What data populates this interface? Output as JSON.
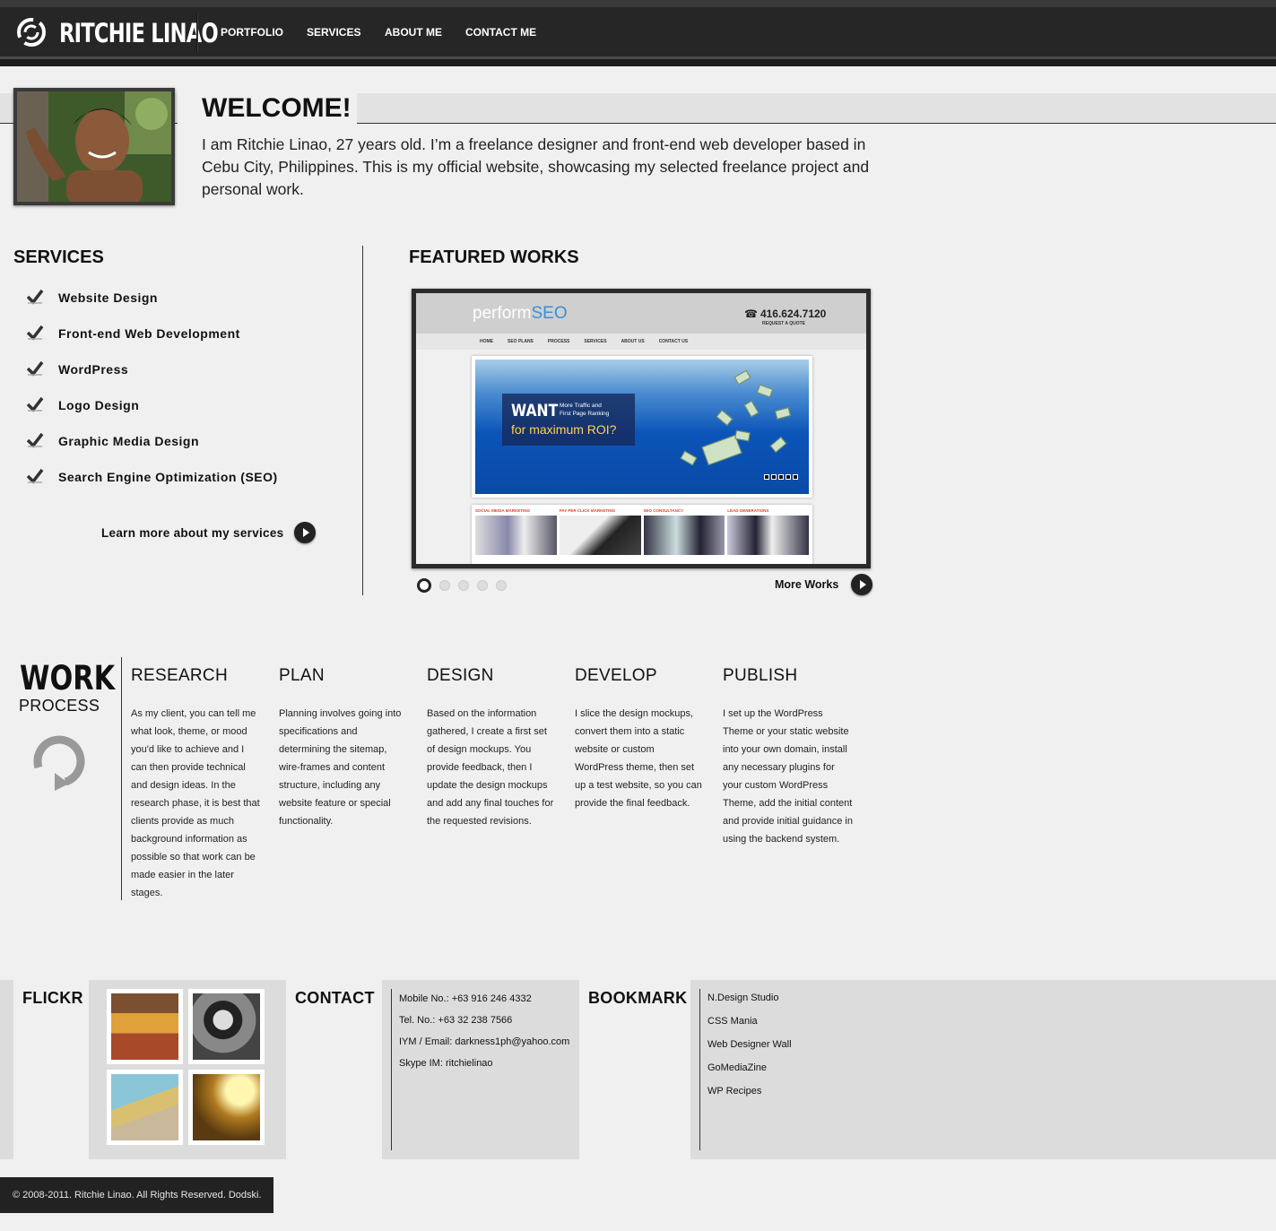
{
  "header": {
    "logo_text": "RITCHIE LINAO",
    "nav": [
      "PORTFOLIO",
      "SERVICES",
      "ABOUT ME",
      "CONTACT ME"
    ]
  },
  "welcome": {
    "title": "WELCOME!",
    "text": "I am Ritchie Linao, 27 years old. I’m a freelance designer and front-end web developer based in Cebu City, Philippines. This is my official website, showcasing my selected freelance project and personal work."
  },
  "services": {
    "title": "SERVICES",
    "items": [
      "Website Design",
      "Front-end Web Development",
      "WordPress",
      "Logo Design",
      "Graphic Media Design",
      "Search Engine Optimization (SEO)"
    ],
    "learn_more": "Learn more about my services"
  },
  "featured": {
    "title": "FEATURED WORKS",
    "more_works": "More Works",
    "slide_count": 5,
    "active_slide": 1,
    "screenshot": {
      "logo_a": "perform",
      "logo_b": "SEO",
      "phone": "416.624.7120",
      "quote": "REQUEST A QUOTE",
      "nav": [
        "HOME",
        "SEO PLANS",
        "PROCESS",
        "SERVICES",
        "ABOUT US",
        "CONTACT US"
      ],
      "banner_want": "WANT",
      "banner_more": "More Traffic and First Page Ranking",
      "banner_roi": "for maximum ROI?",
      "thumbs": [
        "SOCIAL MEDIA MARKETING",
        "PAY PER CLICK MARKETING",
        "SEO CONSULTANCY",
        "LEAD GENERATIONS"
      ]
    }
  },
  "work_process": {
    "work": "WORK",
    "process": "PROCESS",
    "steps": [
      {
        "title": "RESEARCH",
        "text": "As my client, you can tell me what look, theme, or mood you'd like to achieve and I can then provide technical and design ideas. In the research phase, it is best that clients provide as much background information as possible so that work can be made easier in the later stages."
      },
      {
        "title": "PLAN",
        "text": "Planning involves going into specifications and determining the sitemap, wire-frames and content structure, including any website feature or special functionality."
      },
      {
        "title": "DESIGN",
        "text": "Based on the information gathered, I create a first set of design mockups. You provide feedback, then I update the design mockups and add any final touches for the requested revisions."
      },
      {
        "title": "DEVELOP",
        "text": "I slice the design mockups, convert them into a static website or custom WordPress theme, then set up a test website, so you can provide the final feedback."
      },
      {
        "title": "PUBLISH",
        "text": "I set up the WordPress Theme or your static website into your own domain, install any necessary plugins for your custom WordPress Theme, add the initial content and provide initial guidance in using the backend system."
      }
    ]
  },
  "footer": {
    "flickr_title": "FLICKR",
    "contact_title": "CONTACT",
    "contact": [
      "Mobile No.: +63 916 246 4332",
      "Tel. No.: +63 32 238 7566",
      "IYM / Email: darkness1ph@yahoo.com",
      "Skype IM: ritchielinao"
    ],
    "bookmark_title": "BOOKMARK",
    "bookmarks": [
      "N.Design Studio",
      "CSS Mania",
      "Web Designer Wall",
      "GoMediaZine",
      "WP Recipes"
    ],
    "copyright": "© 2008-2011. Ritchie Linao. All Rights Reserved. Dodski."
  }
}
